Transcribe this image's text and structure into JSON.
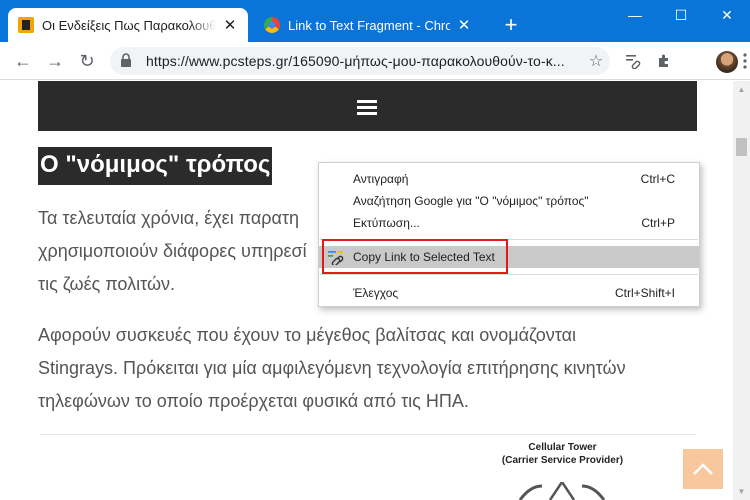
{
  "window": {
    "tabs": [
      {
        "title": "Οι Ενδείξεις Πως Παρακολουθούν",
        "favicon": "pcsteps-favicon",
        "close": "✕"
      },
      {
        "title": "Link to Text Fragment - Chrome W",
        "favicon": "chrome-web-store-favicon",
        "close": "✕"
      }
    ],
    "new_tab": "+",
    "controls": {
      "minimize": "—",
      "maximize": "☐",
      "close": "✕"
    },
    "colors": {
      "titlebar": "#0b74d8"
    }
  },
  "toolbar": {
    "back": "←",
    "forward": "→",
    "reload": "↻",
    "url": "https://www.pcsteps.gr/165090-μήπως-μου-παρακολουθούν-το-κ...",
    "bookmark_icon": "star-icon",
    "extensions": [
      "link-to-text-fragment-icon",
      "puzzle-extensions-icon"
    ],
    "profile_icon": "avatar",
    "menu_icon": "kebab-menu-icon"
  },
  "page": {
    "heading": "Ο \"νόμιμος\" τρόπος",
    "para1_lines": [
      "Τα τελευταία χρόνια, έχει παρατη",
      "χρησιμοποιούν διάφορες υπηρεσί",
      "τις ζωές πολιτών."
    ],
    "para2_lines": [
      "Αφορούν συσκευές που έχουν το μέγεθος βαλίτσας και ονομάζονται",
      "Stingrays. Πρόκειται για μία αμφιλεγόμενη τεχνολογία επιτήρησης κινητών",
      "τηλεφώνων το οποίο προέρχεται φυσικά από τις ΗΠΑ."
    ],
    "diagram": {
      "title_line1": "Cellular Tower",
      "title_line2": "(Carrier Service Provider)"
    }
  },
  "context_menu": {
    "items": [
      {
        "label": "Αντιγραφή",
        "shortcut": "Ctrl+C"
      },
      {
        "label": "Αναζήτηση Google για \"Ο \"νόμιμος\" τρόπος\"",
        "shortcut": ""
      },
      {
        "label": "Εκτύπωση...",
        "shortcut": "Ctrl+P"
      },
      {
        "label": "Copy Link to Selected Text",
        "shortcut": "",
        "icon": "link-to-text-fragment-icon",
        "highlighted": true
      },
      {
        "label": "Έλεγχος",
        "shortcut": "Ctrl+Shift+I"
      }
    ]
  },
  "annotation": {
    "color": "#e31a1a"
  }
}
